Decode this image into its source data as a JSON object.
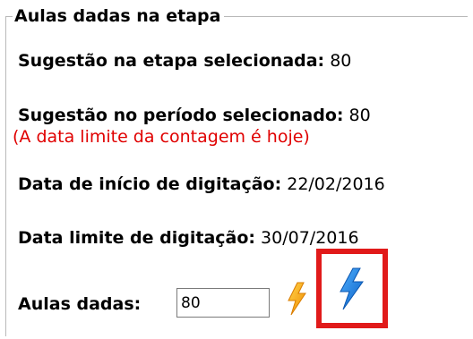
{
  "section": {
    "title": "Aulas dadas na etapa"
  },
  "fields": {
    "sugestao_etapa": {
      "label": "Sugestão na etapa selecionada:",
      "value": " 80"
    },
    "sugestao_periodo": {
      "label": "Sugestão no período selecionado:",
      "value": " 80"
    },
    "nota_data_limite": "(A data limite da contagem é hoje)",
    "data_inicio": {
      "label": "Data de início de digitação:",
      "value": " 22/02/2016"
    },
    "data_limite": {
      "label": "Data limite de digitação:",
      "value": " 30/07/2016"
    },
    "aulas_dadas": {
      "label": "Aulas dadas:",
      "value": "80"
    }
  },
  "icons": {
    "lightning_orange": "lightning-orange-icon",
    "lightning_blue": "lightning-blue-icon"
  },
  "colors": {
    "note_red": "#e00000",
    "highlight_red": "#e11a1a",
    "lightning_orange": "#f5a300",
    "lightning_blue": "#1e7fe0"
  }
}
